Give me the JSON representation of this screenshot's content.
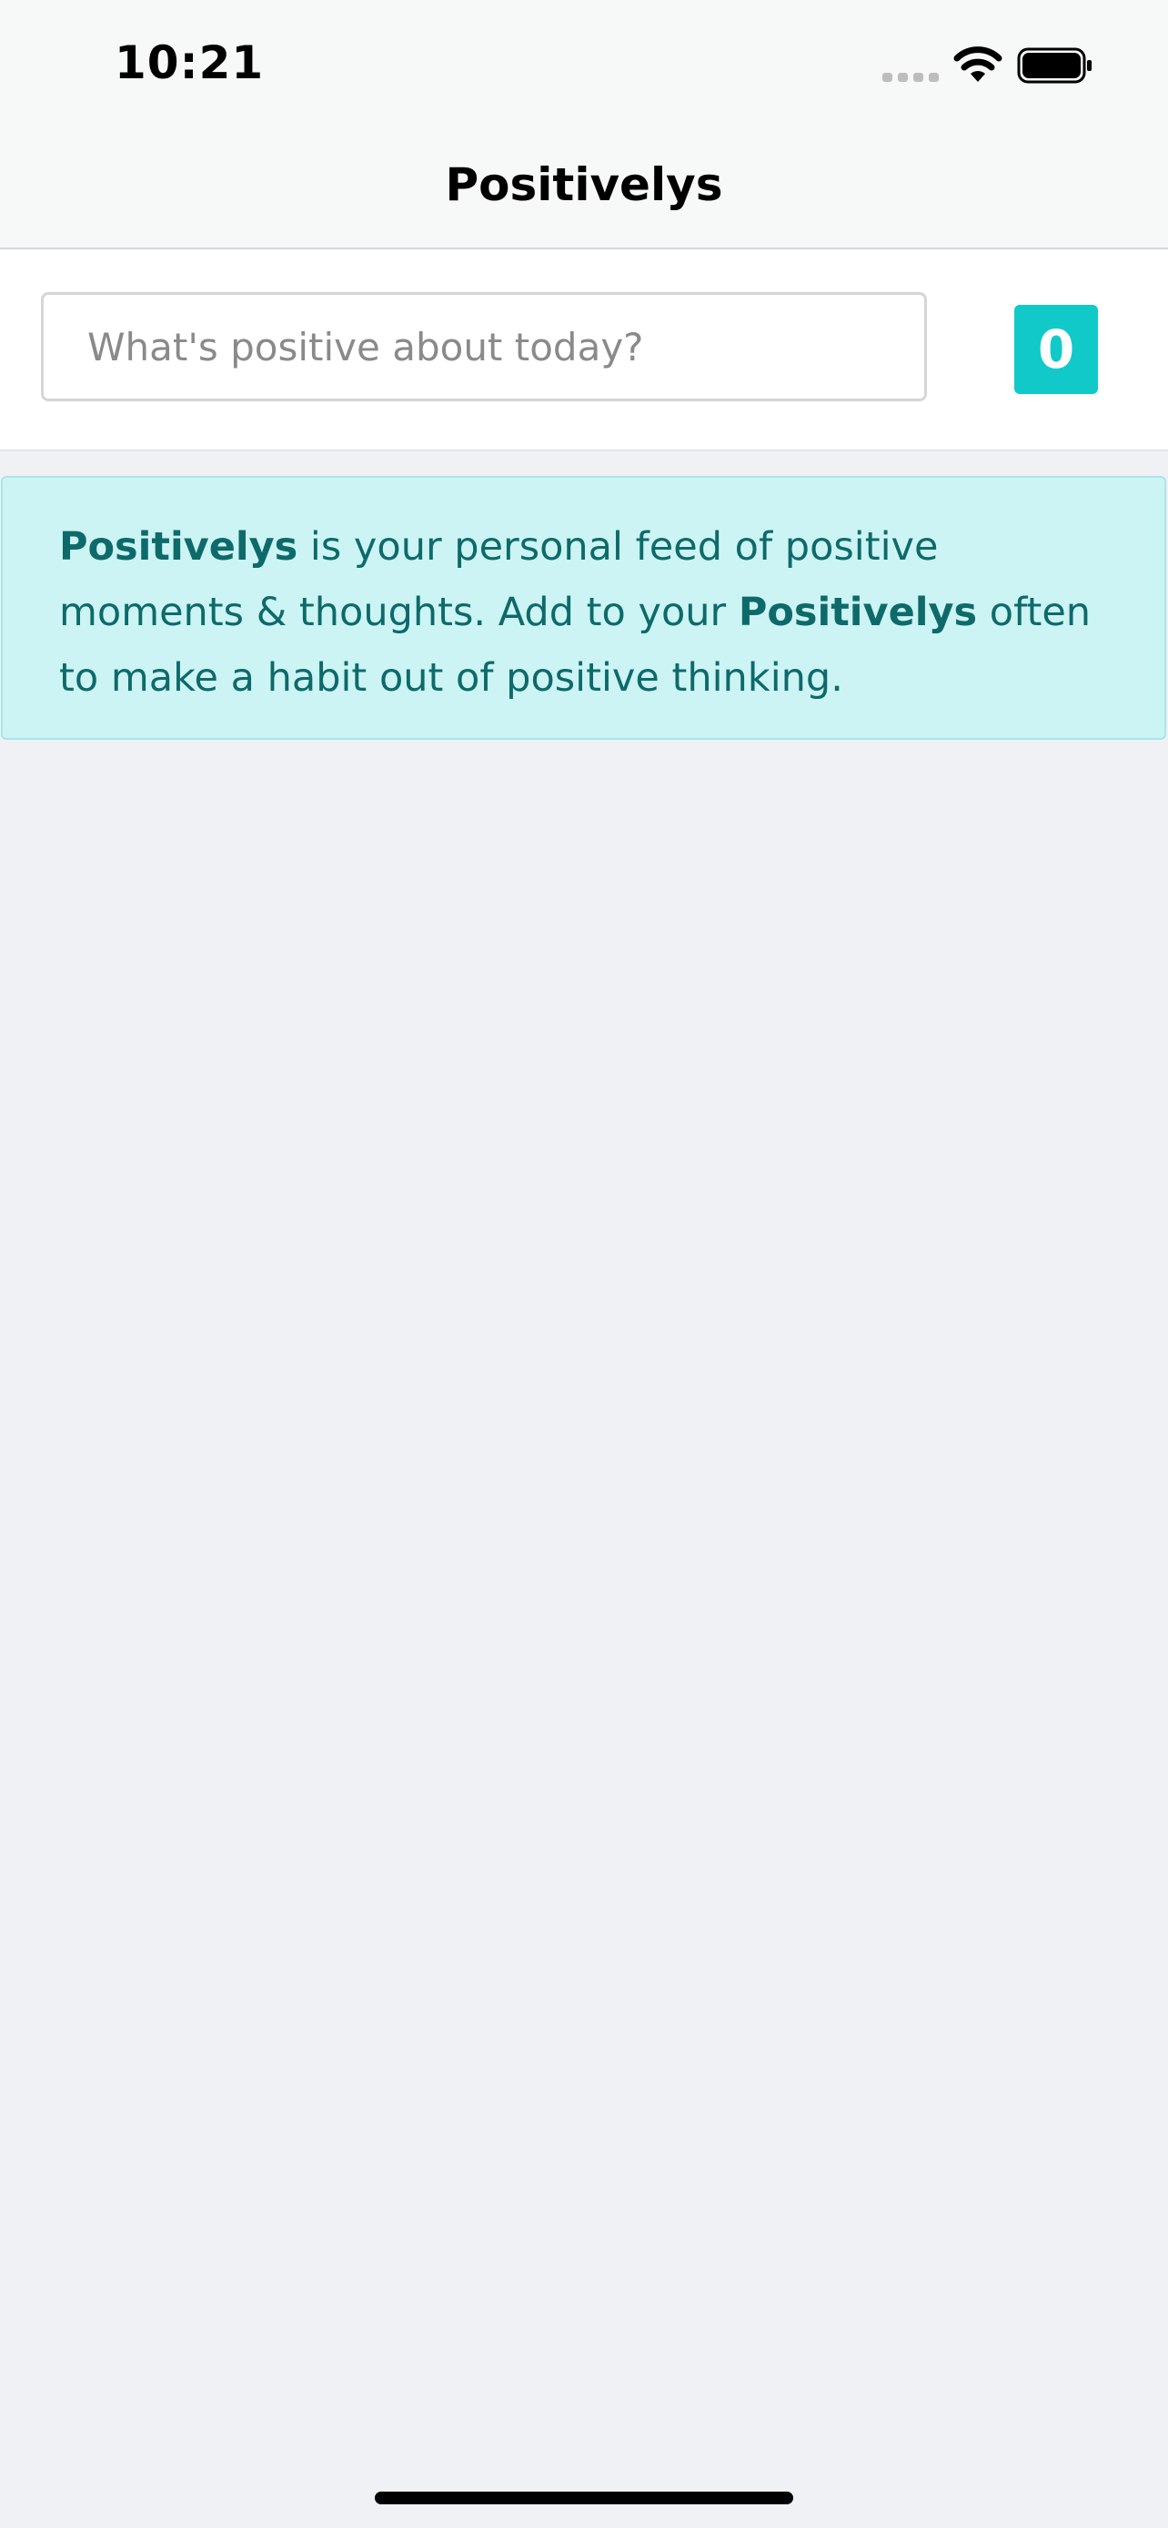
{
  "status_bar": {
    "time": "10:21",
    "icons": [
      "signal-dots-icon",
      "wifi-icon",
      "battery-icon"
    ]
  },
  "nav": {
    "title": "Positivelys"
  },
  "composer": {
    "input_placeholder": "What's positive about today?",
    "input_value": "",
    "count": "0"
  },
  "info": {
    "brand_1": "Positivelys",
    "text_1": " is your personal feed of positive moments & thoughts. Add to your ",
    "brand_2": "Positivelys",
    "text_2": " often to make a habit out of positive thinking."
  },
  "colors": {
    "accent": "#12c9c9",
    "info_background": "#cdf4f4",
    "info_text": "#0e6a6a",
    "page_background": "#eff1f5"
  }
}
